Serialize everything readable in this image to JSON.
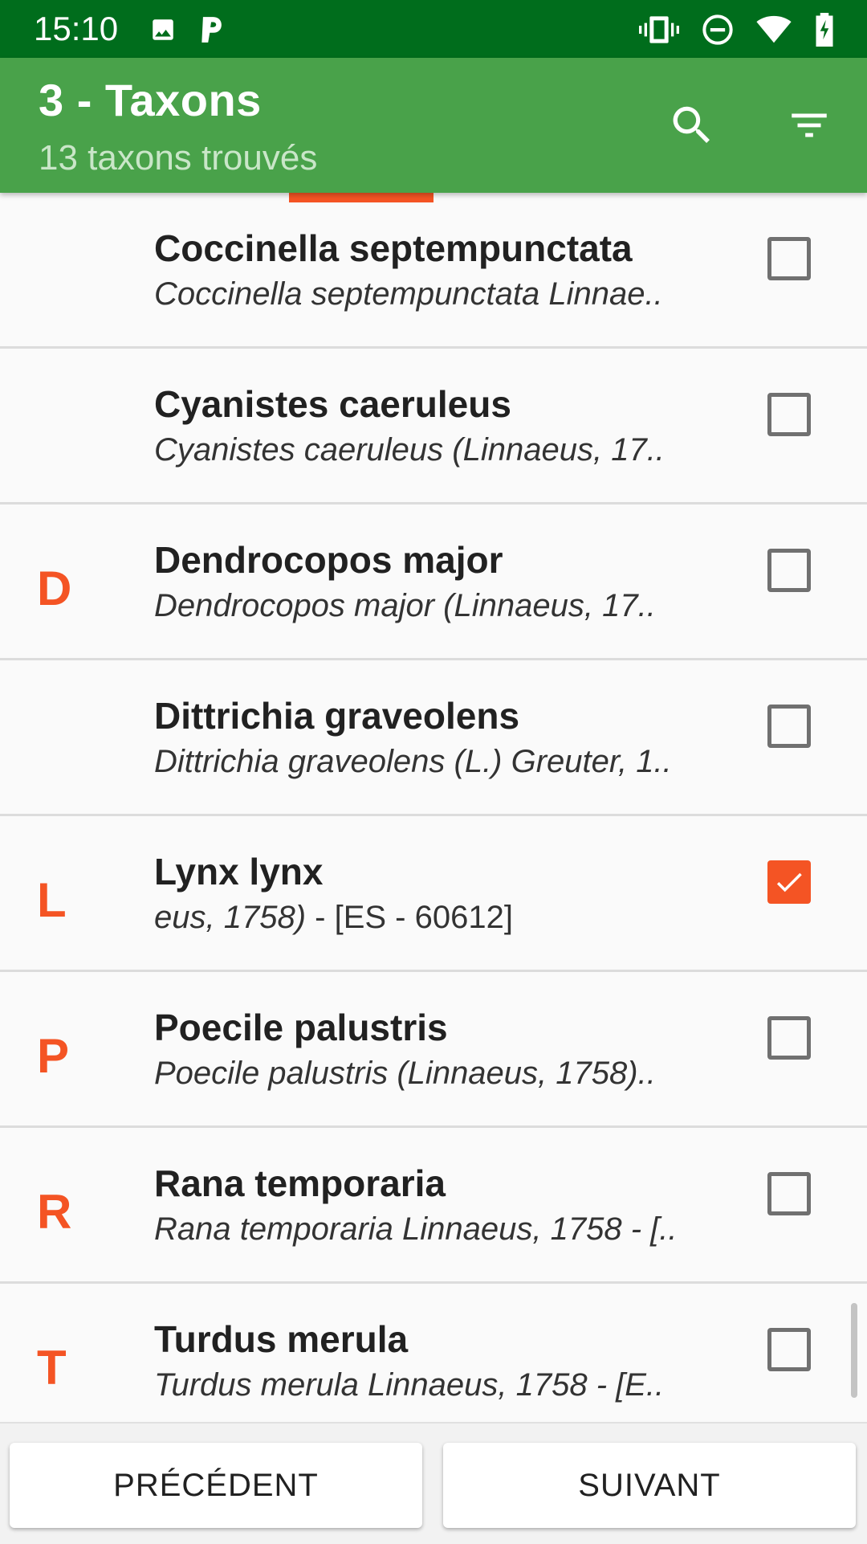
{
  "status_bar": {
    "time": "15:10",
    "left_icons": [
      "image-icon",
      "parking-icon"
    ],
    "right_icons": [
      "vibrate-icon",
      "do-not-disturb-icon",
      "wifi-icon",
      "battery-charging-icon"
    ]
  },
  "appbar": {
    "title": "3 - Taxons",
    "subtitle": "13 taxons trouvés",
    "color": "#49a24a"
  },
  "accent_color": "#f45424",
  "list": [
    {
      "letter": "",
      "name": "Coccinella septempunctata",
      "sub": "Coccinella septempunctata Linnae..",
      "checked": false
    },
    {
      "letter": "",
      "name": "Cyanistes caeruleus",
      "sub": "Cyanistes caeruleus (Linnaeus, 17..",
      "checked": false
    },
    {
      "letter": "D",
      "name": "Dendrocopos major",
      "sub": "Dendrocopos major (Linnaeus, 17..",
      "checked": false
    },
    {
      "letter": "",
      "name": "Dittrichia graveolens",
      "sub": "Dittrichia graveolens (L.) Greuter, 1..",
      "checked": false
    },
    {
      "letter": "L",
      "name": "Lynx lynx",
      "sub_italic": "eus, 1758)",
      "sub_rest": " - [ES - 60612]",
      "checked": true
    },
    {
      "letter": "P",
      "name": "Poecile palustris",
      "sub": "Poecile palustris (Linnaeus, 1758)..",
      "checked": false
    },
    {
      "letter": "R",
      "name": "Rana temporaria",
      "sub": "Rana temporaria Linnaeus, 1758 - [..",
      "checked": false
    },
    {
      "letter": "T",
      "name": "Turdus merula",
      "sub": "Turdus merula Linnaeus, 1758 - [E..",
      "checked": false
    }
  ],
  "buttons": {
    "previous": "PRÉCÉDENT",
    "next": "SUIVANT"
  }
}
